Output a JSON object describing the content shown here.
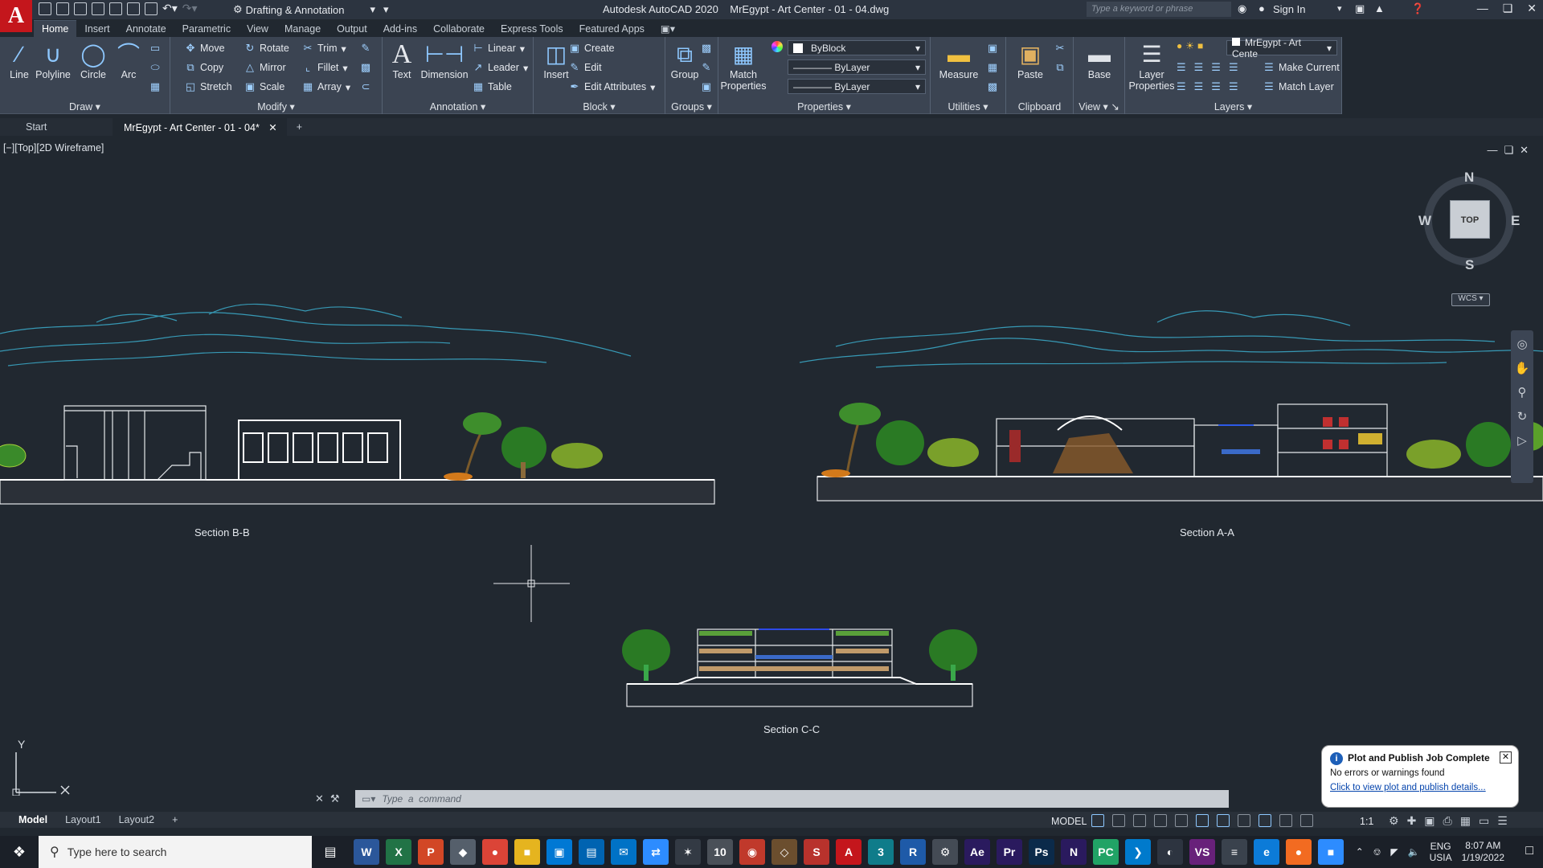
{
  "titlebar": {
    "app_logo": "A",
    "workspace": "Drafting & Annotation",
    "title": "Autodesk AutoCAD 2020    MrEgypt - Art Center - 01 - 04.dwg",
    "search_placeholder": "Type a keyword or phrase",
    "signin": "Sign In"
  },
  "ribbon_tabs": [
    "Home",
    "Insert",
    "Annotate",
    "Parametric",
    "View",
    "Manage",
    "Output",
    "Add-ins",
    "Collaborate",
    "Express Tools",
    "Featured Apps"
  ],
  "ribbon": {
    "draw": {
      "title": "Draw",
      "line": "Line",
      "polyline": "Polyline",
      "circle": "Circle",
      "arc": "Arc"
    },
    "modify": {
      "title": "Modify",
      "move": "Move",
      "rotate": "Rotate",
      "trim": "Trim",
      "copy": "Copy",
      "mirror": "Mirror",
      "fillet": "Fillet",
      "stretch": "Stretch",
      "scale": "Scale",
      "array": "Array"
    },
    "annotation": {
      "title": "Annotation",
      "text": "Text",
      "dimension": "Dimension",
      "linear": "Linear",
      "leader": "Leader",
      "table": "Table"
    },
    "block": {
      "title": "Block",
      "insert": "Insert",
      "create": "Create",
      "edit": "Edit",
      "edit_attributes": "Edit Attributes"
    },
    "groups": {
      "title": "Groups",
      "group": "Group"
    },
    "properties": {
      "title": "Properties",
      "match": "Match Properties",
      "color": "ByBlock",
      "linetype": "ByLayer",
      "lineweight": "ByLayer"
    },
    "utilities": {
      "title": "Utilities",
      "measure": "Measure"
    },
    "clipboard": {
      "title": "Clipboard",
      "paste": "Paste"
    },
    "view": {
      "title": "View",
      "base": "Base"
    },
    "layers": {
      "title": "Layers",
      "layer_properties": "Layer Properties",
      "layer_name": "MrEgypt - Art Cente",
      "make_current": "Make Current",
      "match_layer": "Match Layer"
    }
  },
  "file_tabs": [
    "Start",
    "MrEgypt - Art Center - 01 - 04*"
  ],
  "viewport": {
    "label": "[−][Top][2D Wireframe]",
    "sections": [
      "Section B-B",
      "Section A-A",
      "Section C-C"
    ],
    "viewcube": {
      "n": "N",
      "s": "S",
      "e": "E",
      "w": "W",
      "face": "TOP"
    },
    "wcs": "WCS",
    "ucs_y": "Y"
  },
  "command": {
    "placeholder": "Type  a  command"
  },
  "layout_tabs": [
    "Model",
    "Layout1",
    "Layout2"
  ],
  "status": {
    "model": "MODEL",
    "scale": "1:1"
  },
  "notification": {
    "title": "Plot and Publish Job Complete",
    "body": "No errors or warnings found",
    "link": "Click to view plot and publish details..."
  },
  "taskbar": {
    "search_placeholder": "Type here to search",
    "apps": [
      {
        "label": "W",
        "color": "#2b579a"
      },
      {
        "label": "X",
        "color": "#217346"
      },
      {
        "label": "P",
        "color": "#d24726"
      },
      {
        "label": "◆",
        "color": "#555f6b"
      },
      {
        "label": "●",
        "color": "#db4437"
      },
      {
        "label": "■",
        "color": "#e5b41f"
      },
      {
        "label": "▣",
        "color": "#0078d4"
      },
      {
        "label": "▤",
        "color": "#0063b1"
      },
      {
        "label": "✉",
        "color": "#0072c6"
      },
      {
        "label": "⇄",
        "color": "#2d8cff"
      },
      {
        "label": "✶",
        "color": "#333a44"
      },
      {
        "label": "10",
        "color": "#4a5058"
      },
      {
        "label": "◉",
        "color": "#c0392b"
      },
      {
        "label": "◇",
        "color": "#6b4e2e"
      },
      {
        "label": "S",
        "color": "#b8322c"
      },
      {
        "label": "A",
        "color": "#c4161c"
      },
      {
        "label": "3",
        "color": "#0f7c8a"
      },
      {
        "label": "R",
        "color": "#1e5aa8"
      },
      {
        "label": "⚙",
        "color": "#444b55"
      },
      {
        "label": "Ae",
        "color": "#2a1a5e"
      },
      {
        "label": "Pr",
        "color": "#2a1a5e"
      },
      {
        "label": "Ps",
        "color": "#0b2a4a"
      },
      {
        "label": "N",
        "color": "#2a1a5e"
      },
      {
        "label": "PC",
        "color": "#21a366"
      },
      {
        "label": "❯",
        "color": "#007acc"
      },
      {
        "label": "◐",
        "color": "#2d3440"
      },
      {
        "label": "VS",
        "color": "#68217a"
      },
      {
        "label": "≡",
        "color": "#3a424d"
      },
      {
        "label": "e",
        "color": "#0c7bd8"
      },
      {
        "label": "●",
        "color": "#f26b21"
      },
      {
        "label": "■",
        "color": "#2d8cff"
      }
    ],
    "lang": "ENG",
    "region": "USIA",
    "time": "8:07 AM",
    "date": "1/19/2022"
  }
}
